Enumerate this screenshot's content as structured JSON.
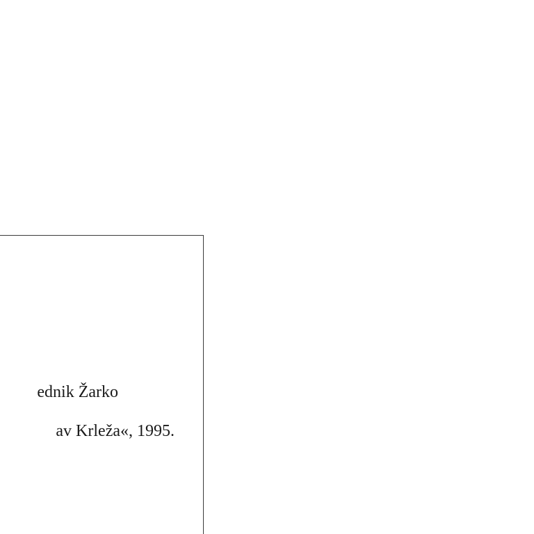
{
  "document": {
    "lines": [
      "ednik Žarko",
      "av Krleža«, 1995."
    ]
  }
}
